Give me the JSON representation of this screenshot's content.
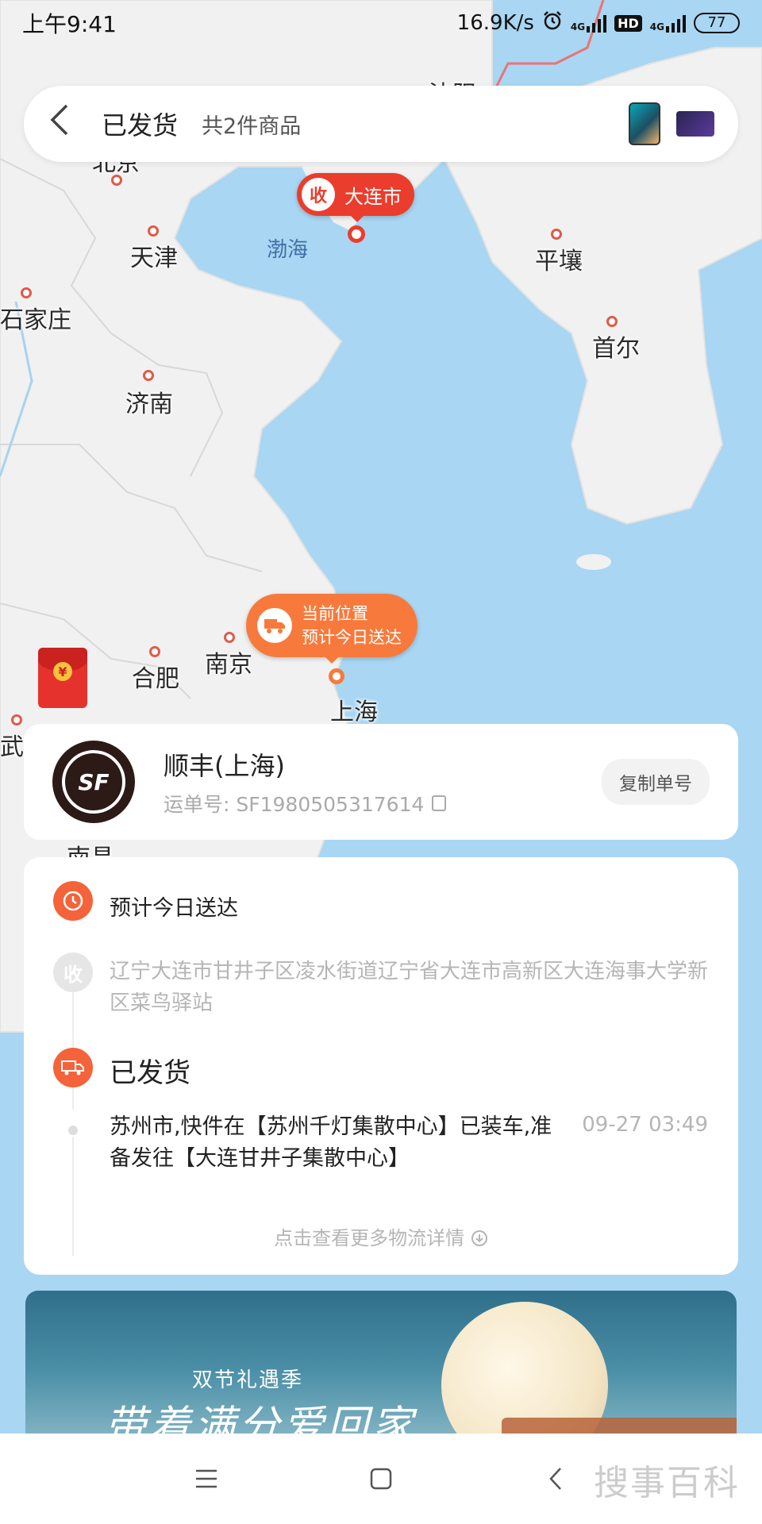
{
  "status_bar": {
    "time": "上午9:41",
    "net_speed": "16.9K/s",
    "network1": "4G",
    "hd": "HD",
    "network2": "4G",
    "battery": "77"
  },
  "header": {
    "title": "已发货",
    "item_count": "共2件商品"
  },
  "map": {
    "labels": {
      "shenyang": "沈阳",
      "beijing": "北京",
      "tianjin": "天津",
      "shijiazhuang": "石家庄",
      "jinan": "济南",
      "bohai": "渤海",
      "pyongyang": "平壤",
      "seoul": "首尔",
      "hefei": "合肥",
      "nanjing": "南京",
      "shanghai": "上海",
      "wuhan": "武汉",
      "nanchang": "南昌"
    },
    "destination_pin": {
      "badge": "收",
      "city": "大连市"
    },
    "current_pin": {
      "line1": "当前位置",
      "line2": "预计今日送达"
    },
    "red_packet_symbol": "¥"
  },
  "courier": {
    "logo_text": "SF",
    "name": "顺丰(上海)",
    "tracking": "运单号: SF1980505317614",
    "copy_label": "复制单号"
  },
  "timeline": {
    "eta": "预计今日送达",
    "recv_badge": "收",
    "address": "辽宁大连市甘井子区凌水街道辽宁省大连市高新区大连海事大学新区菜鸟驿站",
    "status": "已发货",
    "event_text": "苏州市,快件在【苏州千灯集散中心】已装车,准备发往【大连甘井子集散中心】",
    "event_time": "09-27 03:49",
    "more": "点击查看更多物流详情"
  },
  "banner": {
    "subtitle": "双节礼遇季",
    "slogan": "带着满分爱回家"
  },
  "watermark": "搜事百科"
}
